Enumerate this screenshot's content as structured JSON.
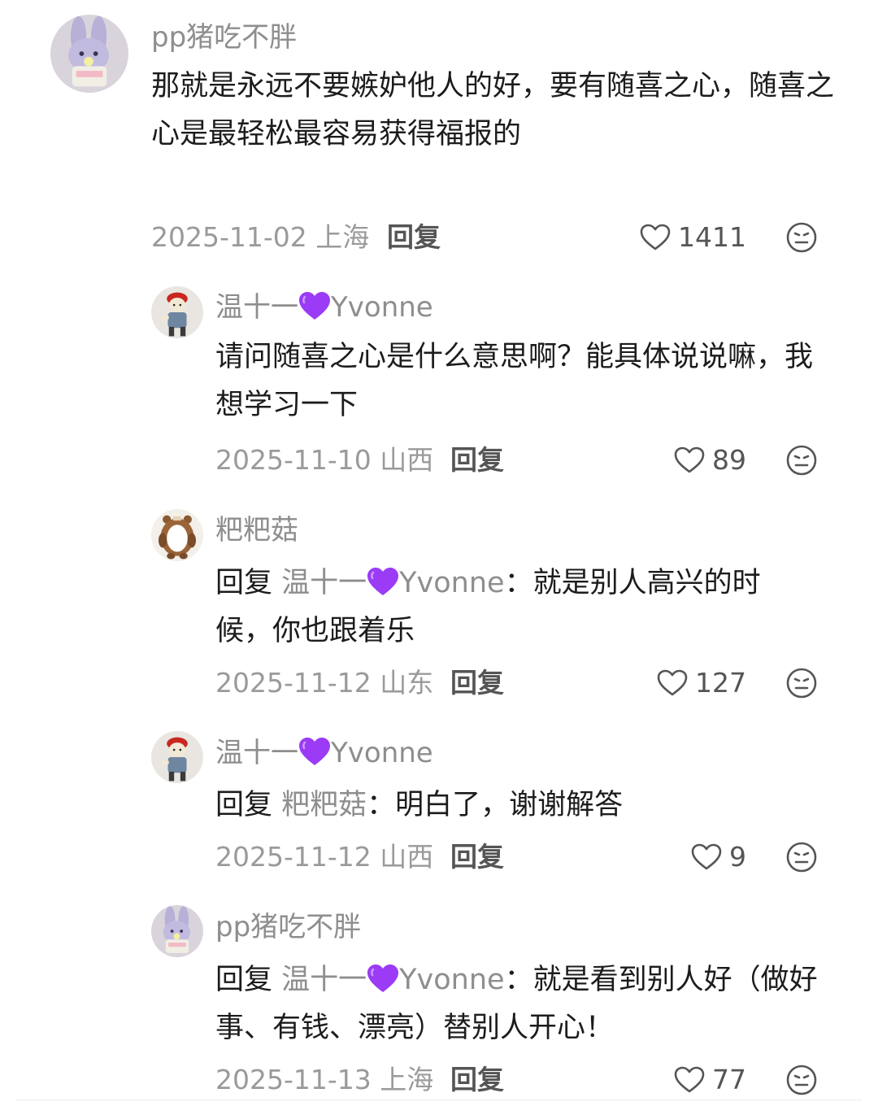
{
  "comments": [
    {
      "username": "pp猪吃不胖",
      "text": "那就是永远不要嫉妒他人的好，要有随喜之心，随喜之心是最轻松最容易获得福报的",
      "date": "2025-11-02",
      "location": "上海",
      "reply_label": "回复",
      "likes": "1411",
      "avatar_icon": "bunny-avatar-icon"
    },
    {
      "username_name": "温十一",
      "username_suffix": "Yvonne",
      "text": "请问随喜之心是什么意思啊？能具体说说嘛，我想学习一下",
      "date": "2025-11-10",
      "location": "山西",
      "reply_label": "回复",
      "likes": "89",
      "avatar_icon": "figure-avatar-icon"
    },
    {
      "username": "粑粑菇",
      "reply_prefix": "回复",
      "reply_to_name": "温十一",
      "reply_to_suffix": "Yvonne",
      "text": "：就是别人高兴的时候，你也跟着乐",
      "date": "2025-11-12",
      "location": "山东",
      "reply_label": "回复",
      "likes": "127",
      "avatar_icon": "plush-avatar-icon"
    },
    {
      "username_name": "温十一",
      "username_suffix": "Yvonne",
      "reply_prefix": "回复",
      "reply_to_name": "粑粑菇",
      "text": "：明白了，谢谢解答",
      "date": "2025-11-12",
      "location": "山西",
      "reply_label": "回复",
      "likes": "9",
      "avatar_icon": "figure-avatar-icon"
    },
    {
      "username": "pp猪吃不胖",
      "reply_prefix": "回复",
      "reply_to_name": "温十一",
      "reply_to_suffix": "Yvonne",
      "text": "：就是看到别人好（做好事、有钱、漂亮）替别人开心！",
      "date": "2025-11-13",
      "location": "上海",
      "reply_label": "回复",
      "likes": "77",
      "avatar_icon": "bunny-avatar-icon"
    }
  ],
  "icons": {
    "like": "heart-outline-icon",
    "dislike": "neutral-face-icon",
    "name_emoji": "purple-heart-icon"
  },
  "colors": {
    "name_emoji": "#9b3bf5",
    "username": "#8e8e8e",
    "meta": "#9a9a9a"
  }
}
